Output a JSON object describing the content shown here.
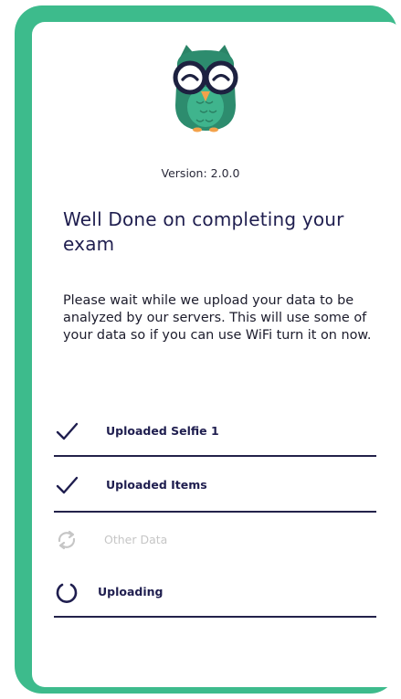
{
  "app": {
    "version": "Version: 2.0.0"
  },
  "heading": {
    "title": "Well Done on completing your exam"
  },
  "message": {
    "text": "Please wait while we upload your data to be analyzed by our servers. This will use some of your data so if you can use WiFi turn it on now."
  },
  "upload_items": [
    {
      "label": "Uploaded Selfie 1",
      "status": "done",
      "icon": "check-icon"
    },
    {
      "label": "Uploaded Items",
      "status": "done",
      "icon": "check-icon"
    },
    {
      "label": "Other Data",
      "status": "pending",
      "icon": "sync-icon"
    },
    {
      "label": "Uploading",
      "status": "in-progress",
      "icon": "spinner-icon"
    }
  ],
  "colors": {
    "frame": "#3dbb8c",
    "primary_text": "#1f1e4f",
    "disabled_text": "#c6c6c6",
    "owl_body": "#2d8c6e",
    "owl_beak": "#f3a24b"
  }
}
